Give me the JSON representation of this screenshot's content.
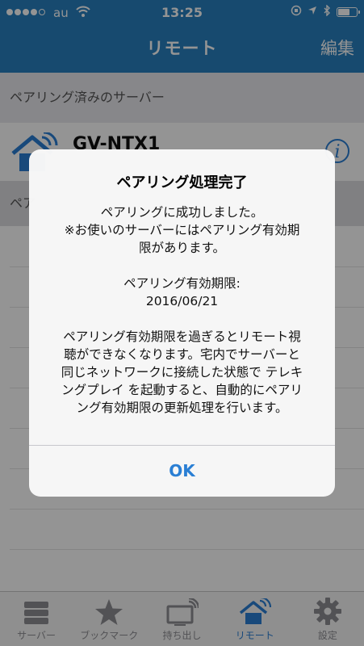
{
  "status_bar": {
    "carrier": "au",
    "time": "13:25"
  },
  "nav": {
    "title": "リモート",
    "edit_label": "編集"
  },
  "sections": {
    "paired_header": "ペアリング済みのサーバー",
    "second_header_visible": "ペア"
  },
  "server": {
    "name": "GV-NTX1"
  },
  "alert": {
    "title": "ペアリング処理完了",
    "body_lines": [
      "ペアリングに成功しました。",
      "※お使いのサーバーにはペアリング有効期",
      "限があります。",
      "",
      "ペアリング有効期限:",
      "2016/06/21",
      "",
      "ペアリング有効期限を過ぎるとリモート視",
      "聴ができなくなります。宅内でサーバーと",
      "同じネットワークに接続した状態で テレキ",
      "ングプレイ を起動すると、自動的にペアリ",
      "ング有効期限の更新処理を行います。"
    ],
    "ok_label": "OK"
  },
  "tabs": [
    {
      "label": "サーバー",
      "icon": "server-icon",
      "active": false
    },
    {
      "label": "ブックマーク",
      "icon": "star-icon",
      "active": false
    },
    {
      "label": "持ち出し",
      "icon": "tv-wireless-icon",
      "active": false
    },
    {
      "label": "リモート",
      "icon": "home-remote-icon",
      "active": true
    },
    {
      "label": "設定",
      "icon": "gear-icon",
      "active": false
    }
  ],
  "colors": {
    "header": "#2980bf",
    "accent": "#2a7fd4",
    "tab_inactive": "#8e8e93"
  }
}
